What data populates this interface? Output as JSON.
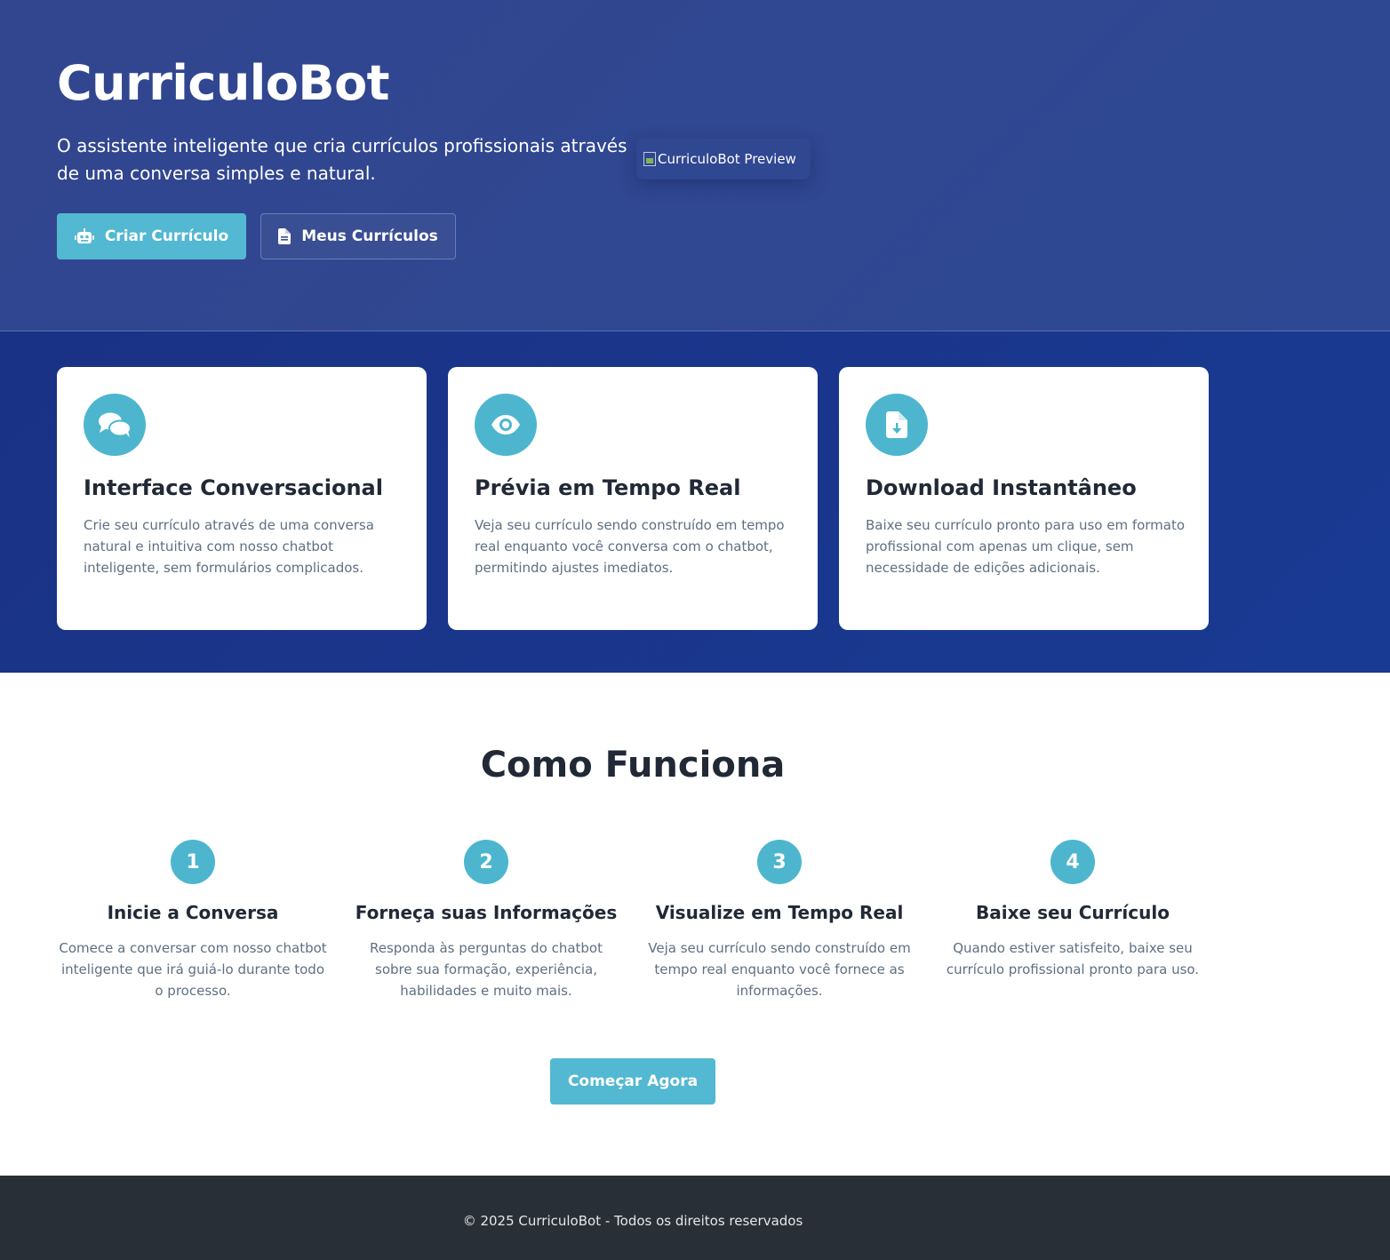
{
  "hero": {
    "title": "CurriculoBot",
    "subtitle": "O assistente inteligente que cria currículos profissionais através de uma conversa simples e natural.",
    "primary_button": "Criar Currículo",
    "secondary_button": "Meus Currículos",
    "preview_alt": "CurriculoBot Preview"
  },
  "features": [
    {
      "icon": "chat-bubbles-icon",
      "title": "Interface Conversacional",
      "text": "Crie seu currículo através de uma conversa natural e intuitiva com nosso chatbot inteligente, sem formulários complicados."
    },
    {
      "icon": "eye-icon",
      "title": "Prévia em Tempo Real",
      "text": "Veja seu currículo sendo construído em tempo real enquanto você conversa com o chatbot, permitindo ajustes imediatos."
    },
    {
      "icon": "file-download-icon",
      "title": "Download Instantâneo",
      "text": "Baixe seu currículo pronto para uso em formato profissional com apenas um clique, sem necessidade de edições adicionais."
    }
  ],
  "how": {
    "title": "Como Funciona",
    "steps": [
      {
        "num": "1",
        "title": "Inicie a Conversa",
        "text": "Comece a conversar com nosso chatbot inteligente que irá guiá-lo durante todo o processo."
      },
      {
        "num": "2",
        "title": "Forneça suas Informações",
        "text": "Responda às perguntas do chatbot sobre sua formação, experiência, habilidades e muito mais."
      },
      {
        "num": "3",
        "title": "Visualize em Tempo Real",
        "text": "Veja seu currículo sendo construído em tempo real enquanto você fornece as informações."
      },
      {
        "num": "4",
        "title": "Baixe seu Currículo",
        "text": "Quando estiver satisfeito, baixe seu currículo profissional pronto para uso."
      }
    ],
    "cta": "Começar Agora"
  },
  "footer": {
    "text": "© 2025 CurriculoBot - Todos os direitos reservados"
  },
  "colors": {
    "hero_bg": "#32468f",
    "features_bg": "#1a3285",
    "accent": "#53b8d1",
    "footer_bg": "#292f36"
  }
}
